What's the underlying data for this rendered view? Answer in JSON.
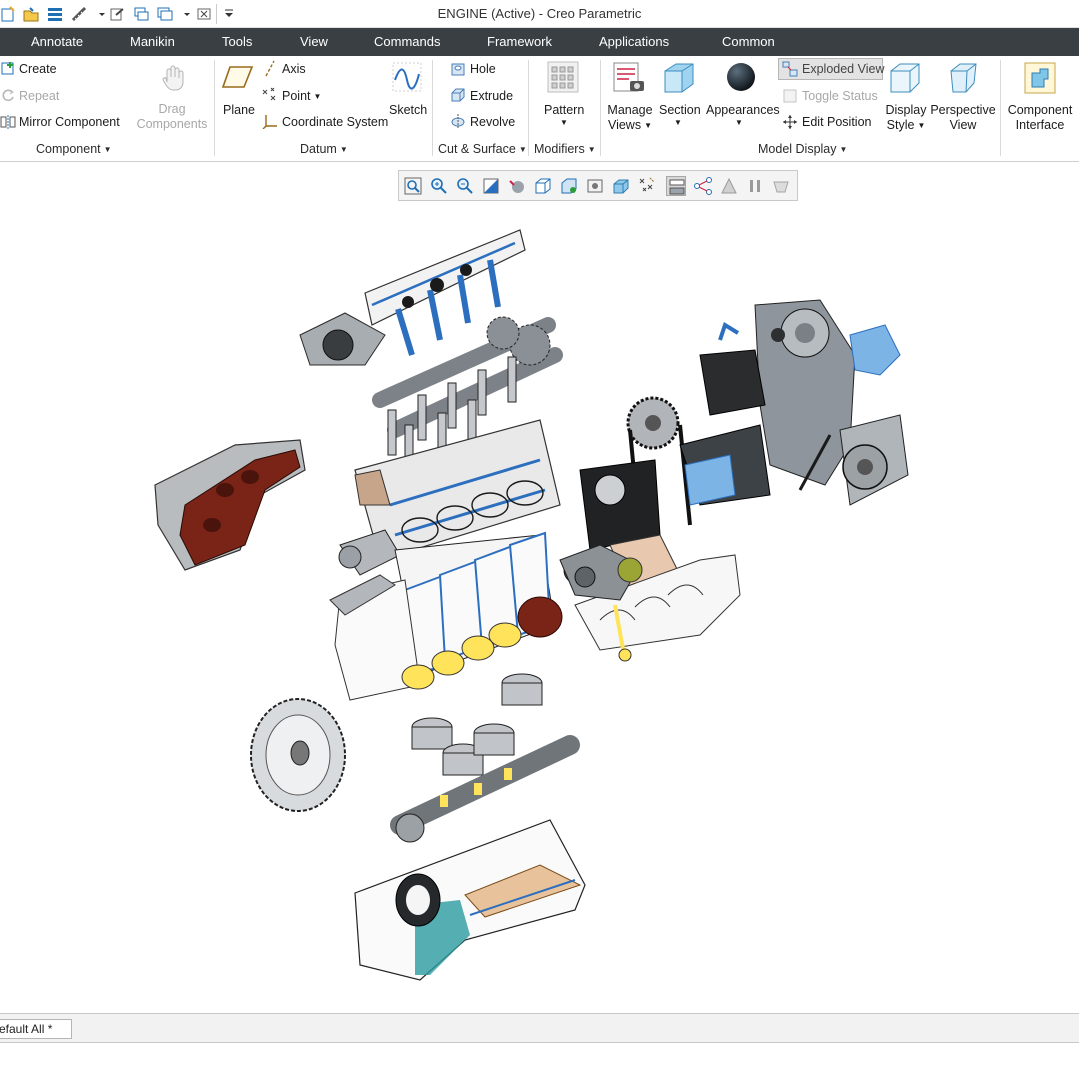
{
  "window": {
    "title": "ENGINE (Active) - Creo Parametric"
  },
  "quick_access": {
    "icons": [
      "new-icon",
      "open-icon",
      "save-icon",
      "ruler-icon",
      "undo-icon",
      "regenerate-icon",
      "windows-icon",
      "close-window-icon",
      "customize-icon"
    ]
  },
  "tabs": [
    "Annotate",
    "Manikin",
    "Tools",
    "View",
    "Commands",
    "Framework",
    "Applications",
    "Common"
  ],
  "ribbon": {
    "component": {
      "create": "Create",
      "repeat": "Repeat",
      "mirror": "Mirror Component",
      "drag_1": "Drag",
      "drag_2": "Components",
      "group": "Component"
    },
    "datum": {
      "plane": "Plane",
      "axis": "Axis",
      "point": "Point",
      "coord": "Coordinate System",
      "sketch": "Sketch",
      "group": "Datum"
    },
    "cut_surface": {
      "hole": "Hole",
      "extrude": "Extrude",
      "revolve": "Revolve",
      "group": "Cut & Surface"
    },
    "modifiers": {
      "pattern": "Pattern",
      "group": "Modifiers"
    },
    "model_display": {
      "manage_1": "Manage",
      "manage_2": "Views",
      "section": "Section",
      "appearances": "Appearances",
      "exploded": "Exploded View",
      "toggle": "Toggle Status",
      "edit_pos": "Edit Position",
      "display_1": "Display",
      "display_2": "Style",
      "persp_1": "Perspective",
      "persp_2": "View",
      "group": "Model Display"
    },
    "component_interface": {
      "line1": "Component",
      "line2": "Interface"
    }
  },
  "graphics_toolbar": {
    "icons": [
      "refit-icon",
      "zoom-in-icon",
      "zoom-out-icon",
      "repaint-icon",
      "spin-center-icon",
      "saved-orientations-icon",
      "named-views-icon",
      "display-style-icon",
      "view-manager-icon",
      "datum-display-icon",
      "annotation-display-icon",
      "exploded-view-icon",
      "pause-icon",
      "layer-icon"
    ]
  },
  "statusbar": {
    "tab_label": "efault All *"
  },
  "colors": {
    "tab_bar": "#3a3f44",
    "part_blue": "#2c6fbf",
    "part_yellow": "#ffe35a",
    "part_red": "#7a2418",
    "part_grey": "#8f959c"
  }
}
